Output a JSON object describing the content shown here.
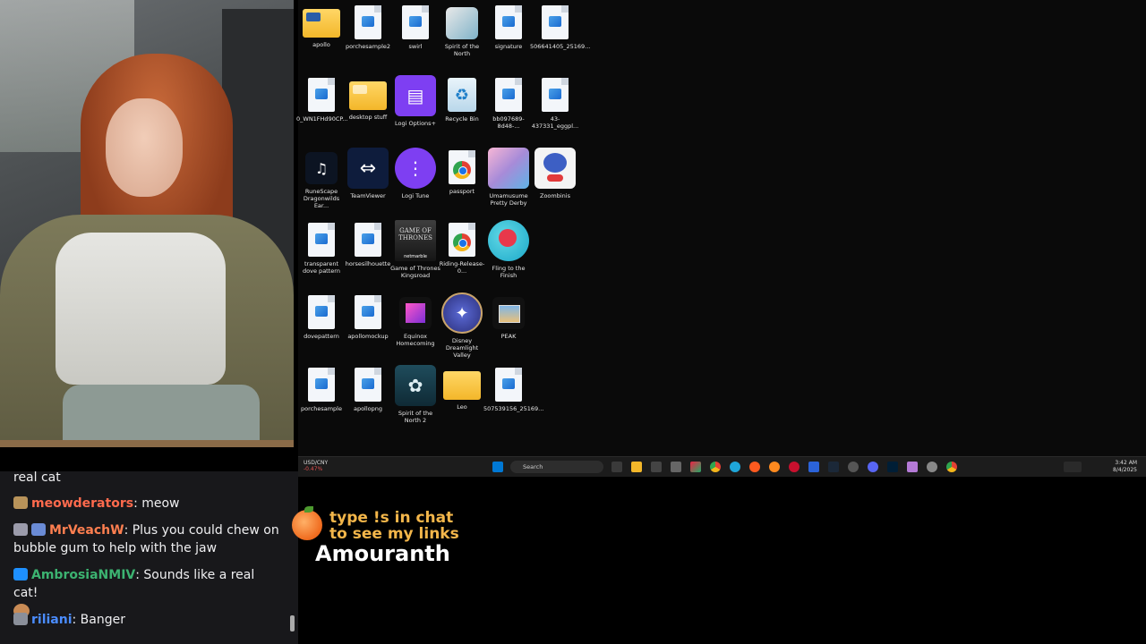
{
  "desktop": {
    "icons": [
      {
        "label": "apollo"
      },
      {
        "label": "porchesample2"
      },
      {
        "label": "swirl"
      },
      {
        "label": "Spirit of the North"
      },
      {
        "label": "signature"
      },
      {
        "label": "506641405_25169..."
      },
      {
        "label": "0_WN1FHd90CP..."
      },
      {
        "label": "desktop stuff"
      },
      {
        "label": "Logi Options+"
      },
      {
        "label": "Recycle Bin"
      },
      {
        "label": "bb097689-8d48-..."
      },
      {
        "label": "43-437331_eggpl..."
      },
      {
        "label": "RuneScape Dragonwilds Ear..."
      },
      {
        "label": "TeamViewer"
      },
      {
        "label": "Logi Tune"
      },
      {
        "label": "passport"
      },
      {
        "label": "Umamusume Pretty Derby"
      },
      {
        "label": "Zoombinis"
      },
      {
        "label": "transparent dove pattern"
      },
      {
        "label": "horsesilhouette"
      },
      {
        "label": "Game of Thrones Kingsroad"
      },
      {
        "label": "Riding-Release-0..."
      },
      {
        "label": "Fling to the Finish"
      },
      {
        "label": "dovepattern"
      },
      {
        "label": "apollomockup"
      },
      {
        "label": "Equinox Homecoming"
      },
      {
        "label": "Disney Dreamlight Valley"
      },
      {
        "label": "PEAK"
      },
      {
        "label": "porchesample"
      },
      {
        "label": "apollopng"
      },
      {
        "label": "Spirit of the North 2"
      },
      {
        "label": "Leo"
      },
      {
        "label": "507539156_25169..."
      }
    ],
    "got_text": "GAME OF THRONES",
    "got_sub": "netmarble"
  },
  "taskbar": {
    "weather_label": "USD/CNY",
    "weather_change": "-0.47%",
    "search_placeholder": "Search",
    "time": "3:42 AM",
    "date": "8/4/2025"
  },
  "chat": {
    "messages": [
      {
        "user": "",
        "text": "real cat"
      },
      {
        "user": "meowderators",
        "text": ": meow",
        "color": "#ff6a4d"
      },
      {
        "user": "MrVeachW",
        "text": ": Plus you could chew on bubble gum to help with the jaw",
        "color": "#ff7f50"
      },
      {
        "user": "AmbrosiaNMIV",
        "text": ": Sounds like a real cat!",
        "color": "#3cb371"
      },
      {
        "user": "riliani",
        "text": ": Banger",
        "color": "#4a8cff"
      }
    ]
  },
  "overlay": {
    "line1": "type !s in chat",
    "line2": "to see my links",
    "name": "Amouranth"
  }
}
